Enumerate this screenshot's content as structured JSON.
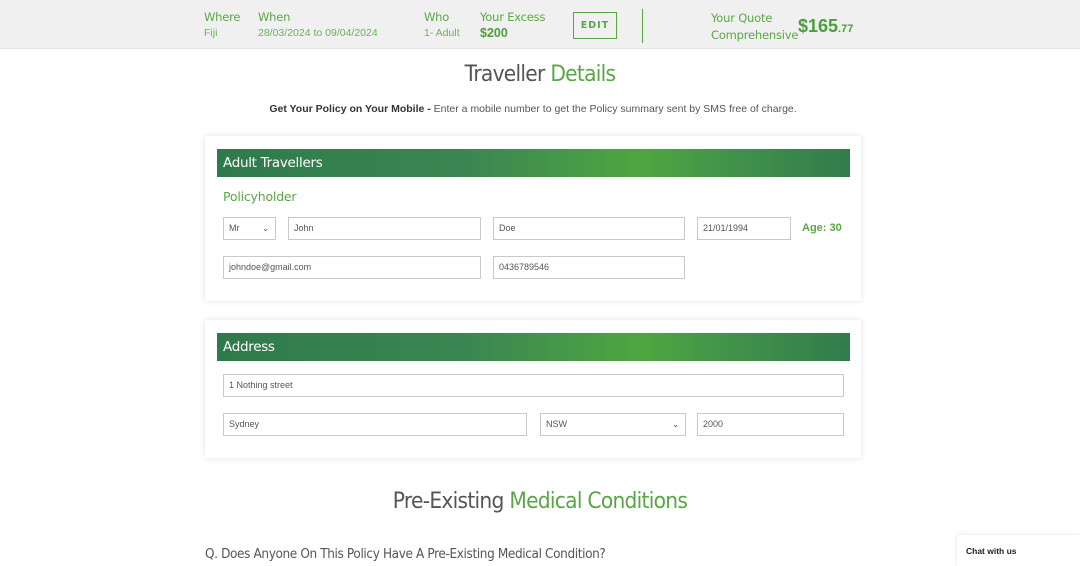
{
  "summary_bar": {
    "where": {
      "label": "Where",
      "value": "Fiji"
    },
    "when": {
      "label": "When",
      "value": "28/03/2024 to 09/04/2024"
    },
    "who": {
      "label": "Who",
      "value": "1- Adult"
    },
    "excess": {
      "label": "Your Excess",
      "value": "$200"
    },
    "edit_label": "EDIT",
    "quote": {
      "label": "Your Quote",
      "plan": "Comprehensive",
      "dollars": "$165",
      "cents": ".77"
    }
  },
  "traveller_details": {
    "title_plain": "Traveller",
    "title_accent": "Details",
    "mobile_prompt_bold": "Get Your Policy on Your Mobile -",
    "mobile_prompt_text": " Enter a mobile number to get the Policy summary sent by SMS free of charge."
  },
  "adult_travellers": {
    "header": "Adult Travellers",
    "policyholder_label": "Policyholder",
    "title_select": "Mr",
    "first_name": "John",
    "last_name": "Doe",
    "dob": "21/01/1994",
    "age_text": "Age: 30",
    "email": "johndoe@gmail.com",
    "mobile": "0436789546"
  },
  "address": {
    "header": "Address",
    "street": "1 Nothing street",
    "suburb": "Sydney",
    "state": "NSW",
    "postcode": "2000"
  },
  "medical": {
    "title_plain": "Pre-Existing",
    "title_accent": "Medical Conditions",
    "question": "Q. Does Anyone On This Policy Have A Pre-Existing Medical Condition?"
  },
  "chat": {
    "label": "Chat with us"
  },
  "colors": {
    "accent": "#5aa646",
    "header_dark": "#2f7a4b"
  }
}
